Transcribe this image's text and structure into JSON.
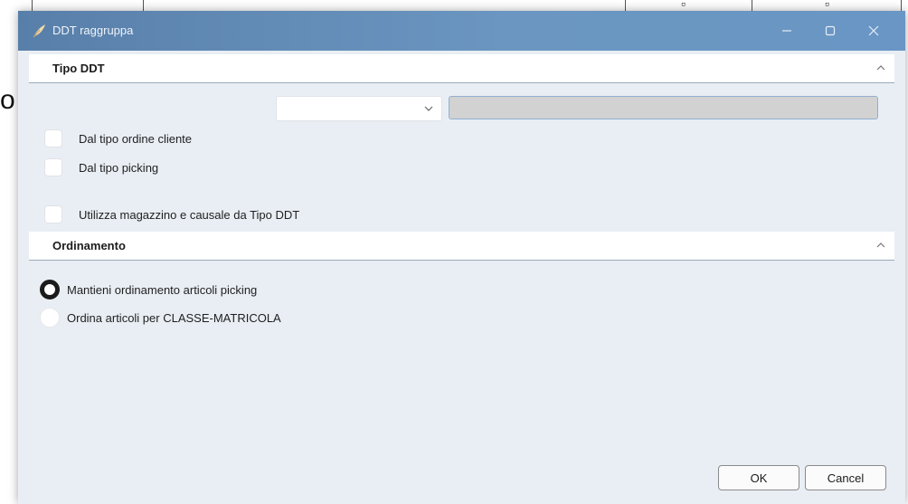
{
  "background": {
    "left_letter": "o"
  },
  "window": {
    "title": "DDT raggruppa",
    "titlebar_color": "#6a94bf",
    "icons": {
      "app": "feather-icon",
      "minimize": "minimize-icon",
      "maximize": "maximize-icon",
      "close": "close-icon"
    }
  },
  "sections": {
    "tipo_ddt": {
      "label": "Tipo DDT",
      "combo_value": "",
      "text_value": "",
      "checkboxes": [
        {
          "label": "Dal tipo ordine cliente",
          "checked": false
        },
        {
          "label": "Dal tipo picking",
          "checked": false
        },
        {
          "label": "Utilizza magazzino e causale da Tipo DDT",
          "checked": false
        }
      ]
    },
    "ordinamento": {
      "label": "Ordinamento",
      "options": [
        {
          "label": "Mantieni ordinamento articoli picking",
          "selected": true
        },
        {
          "label": "Ordina articoli per CLASSE-MATRICOLA",
          "selected": false
        }
      ]
    }
  },
  "buttons": {
    "ok": "OK",
    "cancel": "Cancel"
  }
}
